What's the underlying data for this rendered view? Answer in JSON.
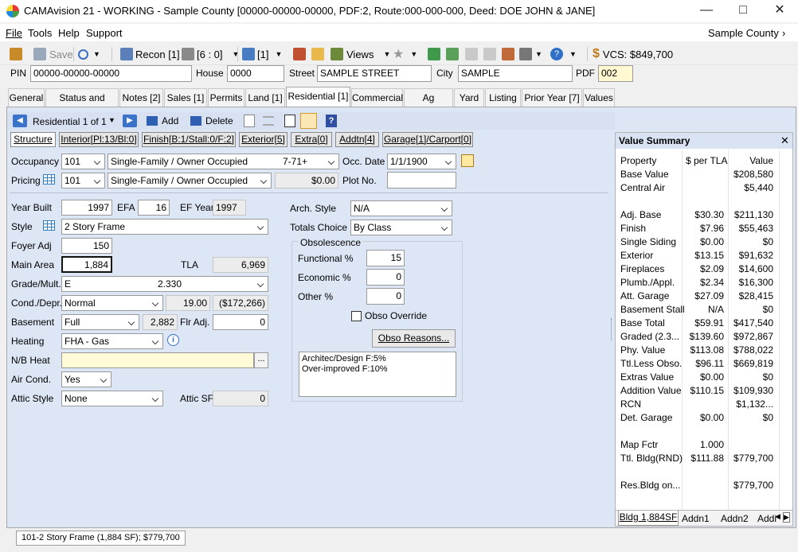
{
  "window": {
    "title": "CAMAvision 21 - WORKING - Sample County [00000-00000-00000, PDF:2, Route:000-000-000, Deed: DOE JOHN & JANE]"
  },
  "menu": {
    "items": [
      "File",
      "Tools",
      "Help",
      "Support"
    ],
    "county": "Sample County"
  },
  "toolbar": {
    "save": "Save",
    "recon": "Recon [1]",
    "six": "[6 : 0]",
    "one": "[1]",
    "views": "Views",
    "vcs": "VCS: $849,700"
  },
  "header": {
    "pin_label": "PIN",
    "pin": "00000-00000-00000",
    "house_label": "House",
    "house": "0000",
    "street_label": "Street",
    "street": "SAMPLE STREET",
    "city_label": "City",
    "city": "SAMPLE",
    "pdf_label": "PDF",
    "pdf": "002"
  },
  "tabs": [
    "General",
    "Status and Legal",
    "Notes [2]",
    "Sales [1]",
    "Permits",
    "Land [1]",
    "Residential [1]",
    "Commercial",
    "Ag Building",
    "Yard",
    "Listing",
    "Prior Year [7]",
    "Values"
  ],
  "restool": {
    "record": "Residential 1 of 1",
    "add": "Add",
    "delete": "Delete"
  },
  "subtabs": [
    "Structure",
    "Interior[Pl:13/Bl:0]",
    "Finish[B:1/Stall:0/F:2]",
    "Exterior[5]",
    "Extra[0]",
    "Addtn[4]",
    "Garage[1]/Carport[0]"
  ],
  "form": {
    "occupancy_label": "Occupancy",
    "occupancy_code": "101",
    "occupancy_desc": "Single-Family / Owner Occupied",
    "occupancy_grade": "7-71+",
    "occ_date_label": "Occ. Date",
    "occ_date": "1/1/1900",
    "pricing_label": "Pricing",
    "pricing_code": "101",
    "pricing_desc": "Single-Family / Owner Occupied",
    "pricing_amount": "$0.00",
    "plot_label": "Plot No.",
    "plot": "",
    "year_built_label": "Year Built",
    "year_built": "1997",
    "efa_label": "EFA",
    "efa": "16",
    "ef_year_label": "EF Year",
    "ef_year": "1997",
    "style_label": "Style",
    "style": "2 Story Frame",
    "foyer_label": "Foyer Adj",
    "foyer": "150",
    "main_area_label": "Main Area",
    "main_area": "1,884",
    "tla_label": "TLA",
    "tla": "6,969",
    "grade_label": "Grade/Mult.",
    "grade": "E",
    "mult": "2.330",
    "cond_label": "Cond./Depr.",
    "cond": "Normal",
    "depr_pct": "19.00",
    "depr_amt": "($172,266)",
    "basement_label": "Basement",
    "basement": "Full",
    "basement_sf": "2,882",
    "flr_adj_label": "Flr Adj.",
    "flr_adj": "0",
    "heating_label": "Heating",
    "heating": "FHA - Gas",
    "nb_heat_label": "N/B Heat",
    "nb_heat": "",
    "air_label": "Air Cond.",
    "air": "Yes",
    "attic_label": "Attic Style",
    "attic": "None",
    "attic_sf_label": "Attic SF",
    "attic_sf": "0",
    "arch_label": "Arch. Style",
    "arch": "N/A",
    "totals_label": "Totals Choice",
    "totals": "By Class",
    "obso_title": "Obsolescence",
    "functional_label": "Functional %",
    "functional": "15",
    "economic_label": "Economic %",
    "economic": "0",
    "other_label": "Other %",
    "other": "0",
    "obso_override_label": "Obso Override",
    "obso_reasons_btn": "Obso Reasons...",
    "notes": [
      "Architec/Design F:5%",
      "Over-improved  F:10%"
    ]
  },
  "value_summary": {
    "title": "Value Summary",
    "headers": [
      "Property",
      "$ per TLA",
      "Value"
    ],
    "rows": [
      [
        "Base Value",
        "",
        "$208,580"
      ],
      [
        "Central Air",
        "",
        "$5,440"
      ],
      [
        "",
        "",
        ""
      ],
      [
        "Adj. Base",
        "$30.30",
        "$211,130"
      ],
      [
        "Finish",
        "$7.96",
        "$55,463"
      ],
      [
        "Single Siding",
        "$0.00",
        "$0"
      ],
      [
        "Exterior",
        "$13.15",
        "$91,632"
      ],
      [
        "Fireplaces",
        "$2.09",
        "$14,600"
      ],
      [
        "Plumb./Appl.",
        "$2.34",
        "$16,300"
      ],
      [
        "Att. Garage",
        "$27.09",
        "$28,415"
      ],
      [
        "Basement Stall",
        "N/A",
        "$0"
      ],
      [
        "Base Total",
        "$59.91",
        "$417,540"
      ],
      [
        "Graded (2.3...",
        "$139.60",
        "$972,867"
      ],
      [
        "Phy. Value",
        "$113.08",
        "$788,022"
      ],
      [
        "Ttl.Less Obso.",
        "$96.11",
        "$669,819"
      ],
      [
        "Extras Value",
        "$0.00",
        "$0"
      ],
      [
        "Addition Value",
        "$110.15",
        "$109,930"
      ],
      [
        "RCN",
        "",
        "$1,132..."
      ],
      [
        "Det. Garage",
        "$0.00",
        "$0"
      ],
      [
        "",
        "",
        ""
      ],
      [
        "Map Fctr",
        "1.000",
        ""
      ],
      [
        "Ttl. Bldg(RND)",
        "$111.88",
        "$779,700"
      ],
      [
        "",
        "",
        ""
      ],
      [
        "Res.Bldg on...",
        "",
        "$779,700"
      ]
    ],
    "bottom_tabs": [
      "Bldg 1,884SF",
      "Addn1",
      "Addn2",
      "Addi"
    ]
  },
  "status": {
    "text": "101-2 Story Frame (1,884 SF); $779,700"
  }
}
